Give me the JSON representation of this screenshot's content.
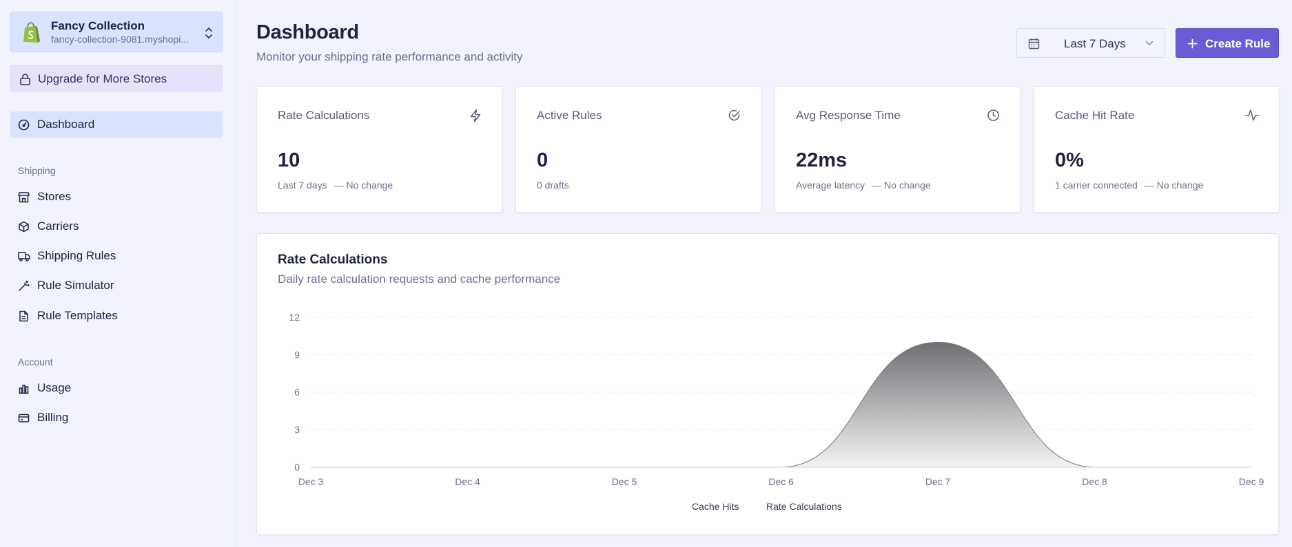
{
  "sidebar": {
    "store": {
      "name": "Fancy Collection",
      "domain": "fancy-collection-9081.myshopi..."
    },
    "upgrade_label": "Upgrade for More Stores",
    "dashboard_label": "Dashboard",
    "sections": {
      "shipping": {
        "title": "Shipping",
        "items": [
          {
            "label": "Stores",
            "icon": "store-icon"
          },
          {
            "label": "Carriers",
            "icon": "box-icon"
          },
          {
            "label": "Shipping Rules",
            "icon": "truck-icon"
          },
          {
            "label": "Rule Simulator",
            "icon": "wand-icon"
          },
          {
            "label": "Rule Templates",
            "icon": "file-icon"
          }
        ]
      },
      "account": {
        "title": "Account",
        "items": [
          {
            "label": "Usage",
            "icon": "bar-chart-icon"
          },
          {
            "label": "Billing",
            "icon": "credit-card-icon"
          }
        ]
      }
    }
  },
  "header": {
    "title": "Dashboard",
    "subtitle": "Monitor your shipping rate performance and activity",
    "date_range": "Last 7 Days",
    "create_label": "Create Rule"
  },
  "stats": [
    {
      "title": "Rate Calculations",
      "value": "10",
      "note": "Last 7 days",
      "change": "— No change",
      "icon": "zap-icon"
    },
    {
      "title": "Active Rules",
      "value": "0",
      "note": "0 drafts",
      "change": "",
      "icon": "check-circle-icon"
    },
    {
      "title": "Avg Response Time",
      "value": "22ms",
      "note": "Average latency",
      "change": "— No change",
      "icon": "clock-icon"
    },
    {
      "title": "Cache Hit Rate",
      "value": "0%",
      "note": "1 carrier connected",
      "change": "— No change",
      "icon": "activity-icon"
    }
  ],
  "chart_section": {
    "title": "Rate Calculations",
    "subtitle": "Daily rate calculation requests and cache performance"
  },
  "chart_data": {
    "type": "area",
    "categories": [
      "Dec 3",
      "Dec 4",
      "Dec 5",
      "Dec 6",
      "Dec 7",
      "Dec 8",
      "Dec 9"
    ],
    "series": [
      {
        "name": "Cache Hits",
        "values": [
          0,
          0,
          0,
          0,
          0,
          0,
          0
        ]
      },
      {
        "name": "Rate Calculations",
        "values": [
          0,
          0,
          0,
          0,
          10,
          0,
          0
        ]
      }
    ],
    "ylim": [
      0,
      12
    ],
    "yticks": [
      0,
      3,
      6,
      9,
      12
    ],
    "grid": true,
    "legend": "bottom-center"
  },
  "colors": {
    "accent": "#6b5bd6",
    "sidebar_active": "#d9e3fb",
    "upgrade_bg": "#e7e1fb",
    "shopify_green": "#95bf47"
  }
}
